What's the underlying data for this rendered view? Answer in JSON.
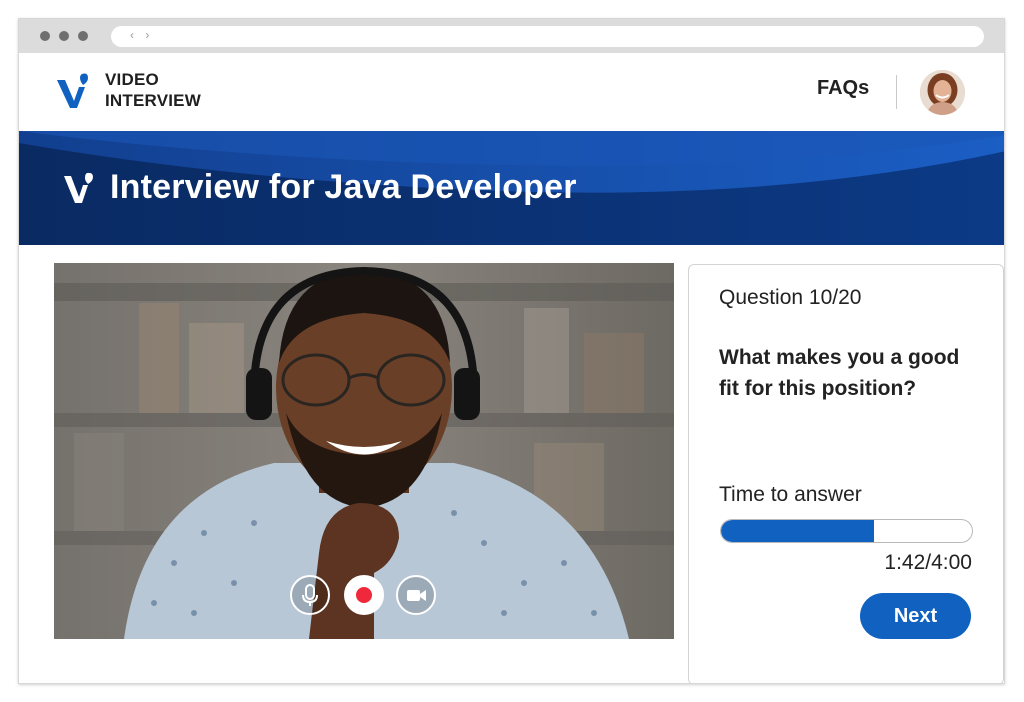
{
  "browser": {
    "nav_arrows": "‹ ›"
  },
  "header": {
    "brand_line1": "VIDEO",
    "brand_line2": "INTERVIEW",
    "faqs_label": "FAQs"
  },
  "banner": {
    "title": "Interview for Java Developer"
  },
  "video": {
    "controls": [
      {
        "name": "mic-button",
        "icon": "microphone-icon"
      },
      {
        "name": "record-button",
        "icon": "record-icon"
      },
      {
        "name": "camera-button",
        "icon": "video-camera-icon"
      }
    ]
  },
  "question_panel": {
    "question_number": "Question 10/20",
    "question_text": "What makes you a good fit for this position?",
    "time_label": "Time to answer",
    "time_value": "1:42/4:00",
    "progress_fraction": 0.61,
    "next_label": "Next"
  },
  "colors": {
    "primary_blue": "#1162c0",
    "banner_navy": "#0b2f6b",
    "record_red": "#f0283c"
  }
}
